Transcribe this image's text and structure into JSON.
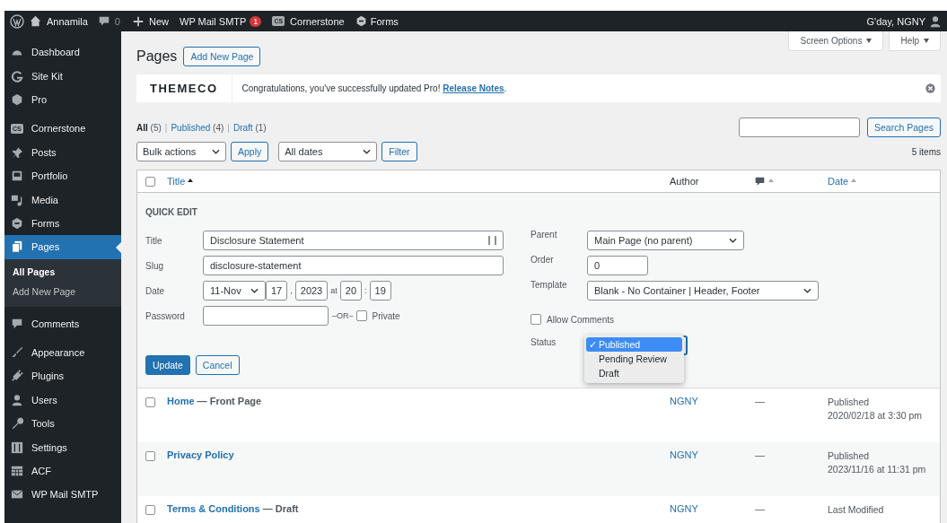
{
  "admin_bar": {
    "site": "Annamila",
    "comments": "0",
    "new": "New",
    "smtp": "WP Mail SMTP",
    "smtp_badge": "1",
    "cs_badge": "CS",
    "cornerstone": "Cornerstone",
    "forms": "Forms",
    "greeting": "G'day, NGNY"
  },
  "sidebar": {
    "items": [
      {
        "label": "Dashboard",
        "selected": false
      },
      {
        "label": "Site Kit",
        "selected": false
      },
      {
        "label": "Pro",
        "selected": false
      },
      {
        "label": "Cornerstone",
        "selected": false,
        "badge": "CS"
      },
      {
        "label": "Posts",
        "selected": false
      },
      {
        "label": "Portfolio",
        "selected": false
      },
      {
        "label": "Media",
        "selected": false
      },
      {
        "label": "Forms",
        "selected": false
      },
      {
        "label": "Pages",
        "selected": true,
        "children": [
          {
            "label": "All Pages",
            "selected": true
          },
          {
            "label": "Add New Page",
            "selected": false
          }
        ]
      },
      {
        "label": "Comments",
        "selected": false
      },
      {
        "label": "Appearance",
        "selected": false
      },
      {
        "label": "Plugins",
        "selected": false
      },
      {
        "label": "Users",
        "selected": false
      },
      {
        "label": "Tools",
        "selected": false
      },
      {
        "label": "Settings",
        "selected": false
      },
      {
        "label": "ACF",
        "selected": false
      },
      {
        "label": "WP Mail SMTP",
        "selected": false
      }
    ]
  },
  "header": {
    "title": "Pages",
    "add_button": "Add New Page",
    "screen_options": "Screen Options",
    "help": "Help"
  },
  "notice": {
    "logo": "THEMECO",
    "text": "Congratulations, you've successfully updated Pro! ",
    "link": "Release Notes",
    "after": "."
  },
  "views": [
    {
      "label": "All",
      "count": "(5)",
      "selected": true
    },
    {
      "separator": "|",
      "label": "Published",
      "count": "(4)",
      "selected": false
    },
    {
      "separator": "|",
      "label": "Draft",
      "count": "(1)",
      "selected": false
    }
  ],
  "toolbar": {
    "bulk": "Bulk actions",
    "apply": "Apply",
    "dates": "All dates",
    "filter": "Filter",
    "search_button": "Search Pages",
    "items": "5 items"
  },
  "table": {
    "select_all_checked": false,
    "columns": {
      "title": "Title",
      "author": "Author",
      "date": "Date"
    },
    "quick_edit": {
      "heading": "QUICK EDIT",
      "title_label": "Title",
      "title_value": "Disclosure Statement",
      "slug_label": "Slug",
      "slug_value": "disclosure-statement",
      "date_label": "Date",
      "month": "11-Nov",
      "day": "17",
      "comma": ",",
      "year": "2023",
      "at": "at",
      "hour": "20",
      "colon": ":",
      "minute": "19",
      "password_label": "Password",
      "or": "–OR–",
      "private_label": "Private",
      "private_checked": false,
      "parent_label": "Parent",
      "parent_value": "Main Page (no parent)",
      "order_label": "Order",
      "order_value": "0",
      "template_label": "Template",
      "template_value": "Blank - No Container | Header, Footer",
      "comments_label": "Allow Comments",
      "comments_checked": false,
      "status_label": "Status",
      "status_options": [
        {
          "label": "Published",
          "selected": true,
          "mark": "✓"
        },
        {
          "label": "Pending Review",
          "selected": false
        },
        {
          "label": "Draft",
          "selected": false
        }
      ],
      "update": "Update",
      "cancel": "Cancel"
    },
    "rows": [
      {
        "checked": false,
        "title": "Home",
        "state": " — Front Page",
        "author": "NGNY",
        "comments": "—",
        "date_status": "Published",
        "date": "2020/02/18 at 3:30 pm"
      },
      {
        "checked": false,
        "title": "Privacy Policy",
        "author": "NGNY",
        "comments": "—",
        "date_status": "Published",
        "date": "2023/11/16 at 11:31 pm"
      },
      {
        "checked": false,
        "title": "Terms & Conditions",
        "state": " — Draft",
        "author": "NGNY",
        "comments": "—",
        "date_status": "Last Modified"
      }
    ]
  }
}
